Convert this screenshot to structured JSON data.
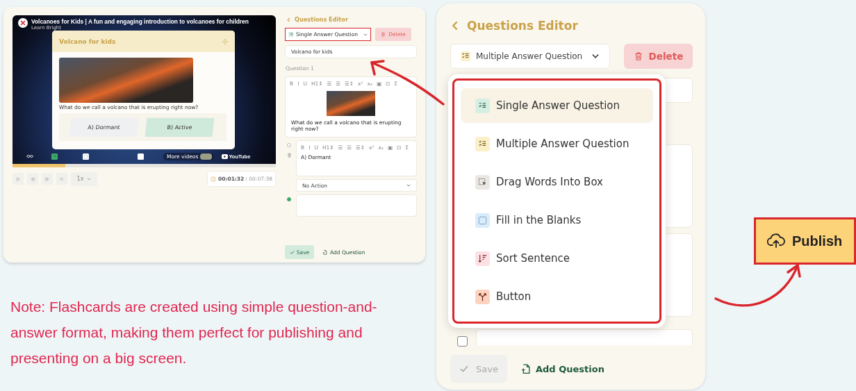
{
  "video_card": {
    "video": {
      "title": "Volcanoes for Kids | A fun and engaging introduction to volcanoes for children",
      "channel": "Learn Bright",
      "more_videos": "More videos",
      "youtube": "YouTube",
      "question_card": {
        "title": "Volcano for kids",
        "question": "What do we call a volcano that is erupting right now?",
        "answers": [
          {
            "text": "A) Dormant",
            "correct": false
          },
          {
            "text": "B) Active",
            "correct": true
          }
        ]
      },
      "markers": [
        {
          "kind": "single",
          "selected": true
        },
        {
          "kind": "blank",
          "selected": false
        },
        {
          "kind": "list",
          "selected": false
        }
      ],
      "progress": {
        "level": 0.2
      }
    },
    "controls": {
      "speed": "1x",
      "current_time": "00:01:32",
      "total_time": "00:07:38"
    },
    "editor": {
      "title": "Questions Editor",
      "type_select": "Single Answer Question",
      "delete": "Delete",
      "title_field": "Volcano for kids",
      "question_label": "Question 1",
      "question_toolbar": [
        "B",
        "I",
        "U",
        "H1↕",
        "☰",
        "☰",
        "☰↕",
        "x²",
        "x₂",
        "▣",
        "⊡",
        "Σ"
      ],
      "question_text": "What do we call a volcano that is erupting right now?",
      "answers": [
        {
          "text": "A) Dormant",
          "correct": false,
          "toolbar": [
            "B",
            "I",
            "U",
            "H1↕",
            "☰",
            "☰",
            "☰↕",
            "x²",
            "x₂",
            "▣",
            "⊡",
            "Σ"
          ],
          "action": "No Action"
        },
        {
          "correct": true
        }
      ],
      "save": {
        "label": "Save",
        "disabled": false
      },
      "add": "Add Question"
    }
  },
  "note": "Note: Flashcards are created using simple question-and-answer format, making them perfect for publishing and presenting on a big screen.",
  "panel": {
    "title": "Questions Editor",
    "type_select": "Multiple Answer Question",
    "delete": "Delete",
    "menu": [
      {
        "label": "Single Answer Question",
        "kind": "single",
        "color": "#d5efe3",
        "selected": true
      },
      {
        "label": "Multiple Answer Question",
        "kind": "multiple",
        "color": "#fbf0c8",
        "selected": false
      },
      {
        "label": "Drag Words Into Box",
        "kind": "drag",
        "color": "#ebe8e3",
        "selected": false
      },
      {
        "label": "Fill in the Blanks",
        "kind": "blank",
        "color": "#d9ecfb",
        "selected": false
      },
      {
        "label": "Sort Sentence",
        "kind": "sort",
        "color": "#fde0e3",
        "selected": false
      },
      {
        "label": "Button",
        "kind": "button",
        "color": "#fdd3c0",
        "selected": false
      }
    ],
    "answer_checkbox": {
      "checked": false
    },
    "save": {
      "label": "Save",
      "disabled": true
    },
    "add": "Add Question"
  },
  "publish": "Publish"
}
